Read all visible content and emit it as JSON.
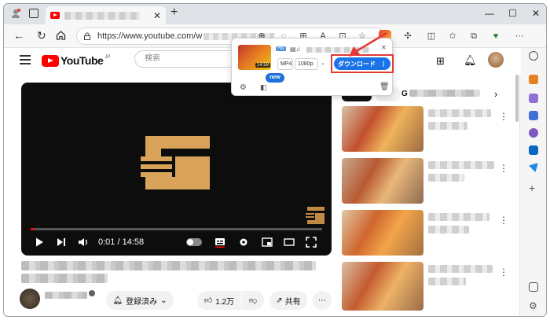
{
  "browser": {
    "url": "https://www.youtube.com/w",
    "new_tab": "+",
    "window_controls": [
      "—",
      "☐",
      "✕"
    ]
  },
  "youtube": {
    "logo_text": "YouTube",
    "region": "JP",
    "search_placeholder": "検索",
    "video": {
      "time_current": "0:01",
      "time_total": "14:58",
      "time_separator": " / ",
      "progress": 0.01
    },
    "actions": {
      "subscribe": "登録済み",
      "likes": "1.2万",
      "share": "共有"
    },
    "recommend_chip": "G"
  },
  "downloader": {
    "duration": "14:59",
    "format": "MP4",
    "quality": "1080p",
    "download_label": "ダウンロード",
    "hls_tag": "Hls",
    "new_badge": "new"
  },
  "colors": {
    "yt_red": "#ff0000",
    "logo_gold": "#d9a35a",
    "download_blue": "#1a73e8",
    "highlight_red": "#e53935"
  }
}
